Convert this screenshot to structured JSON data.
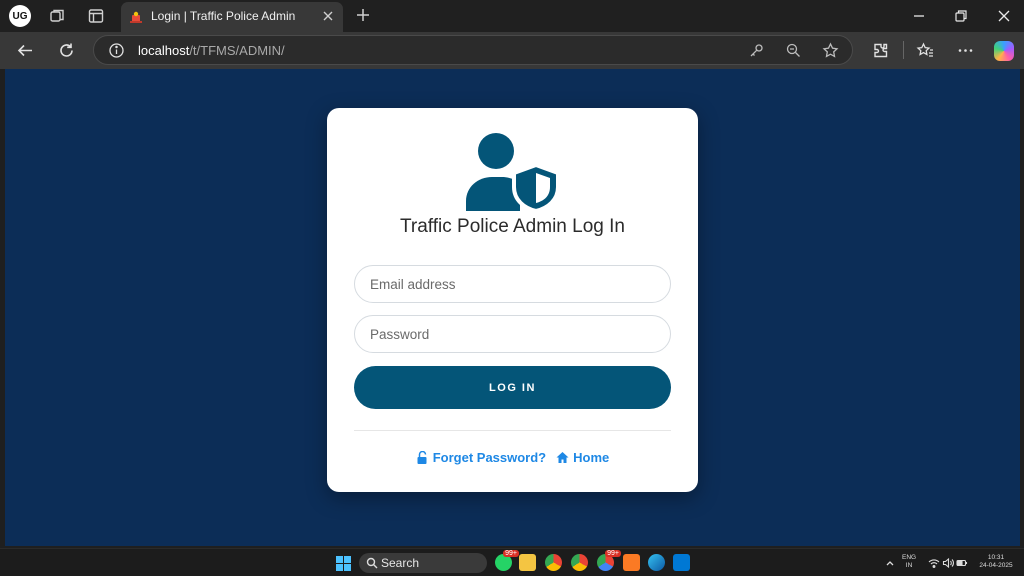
{
  "browser": {
    "profile_initials": "UG",
    "tab_title": "Login | Traffic Police Admin",
    "url_host": "localhost",
    "url_path": "/t/TFMS/ADMIN/"
  },
  "login": {
    "title": "Traffic Police Admin Log In",
    "email_placeholder": "Email address",
    "password_placeholder": "Password",
    "login_button": "LOG IN",
    "forgot_link": "Forget Password?",
    "home_link": "Home"
  },
  "taskbar": {
    "search_label": "Search",
    "badge_1": "99+",
    "badge_2": "99+",
    "lang_1": "ENG",
    "lang_2": "IN",
    "time": "10:31",
    "date": "24-04-2025"
  },
  "colors": {
    "page_bg": "#0c2d57",
    "primary": "#045578",
    "link": "#1e88e5"
  }
}
